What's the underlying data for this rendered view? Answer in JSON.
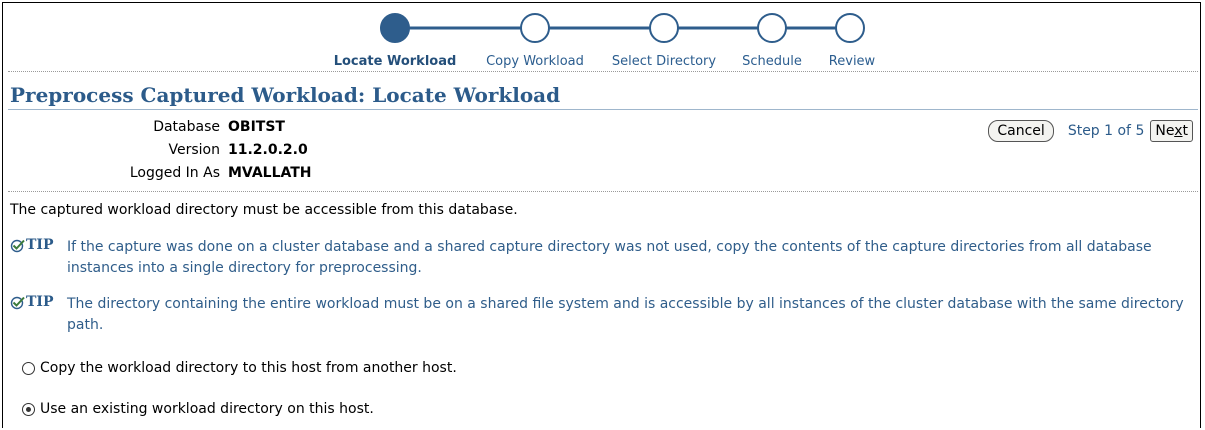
{
  "train": {
    "steps": [
      {
        "label": "Locate Workload",
        "state": "current"
      },
      {
        "label": "Copy Workload",
        "state": "pending"
      },
      {
        "label": "Select Directory",
        "state": "pending"
      },
      {
        "label": "Schedule",
        "state": "pending"
      },
      {
        "label": "Review",
        "state": "pending"
      }
    ],
    "colors": {
      "active": "#2e5d8c",
      "line": "#2e5d8c"
    }
  },
  "page": {
    "title": "Preprocess Captured Workload: Locate Workload"
  },
  "info": {
    "database_label": "Database",
    "database_value": "OBITST",
    "version_label": "Version",
    "version_value": "11.2.0.2.0",
    "logged_label": "Logged In As",
    "logged_value": "MVALLATH"
  },
  "nav": {
    "cancel_label": "Cancel",
    "step_text": "Step 1 of 5",
    "next_first": "Ne",
    "next_underlined": "x",
    "next_rest": "t"
  },
  "content": {
    "description": "The captured workload directory must be accessible from this database.",
    "tip_label": "TIP",
    "tip1": "If the capture was done on a cluster database and a shared capture directory was not used, copy the contents of the capture directories from all database instances into a single directory for preprocessing.",
    "tip2": "The directory containing the entire workload must be on a shared file system and is accessible by all instances of the cluster database with the same directory path.",
    "option_copy": "Copy the workload directory to this host from another host.",
    "option_existing": "Use an existing workload directory on this host.",
    "selected_option": "existing"
  }
}
